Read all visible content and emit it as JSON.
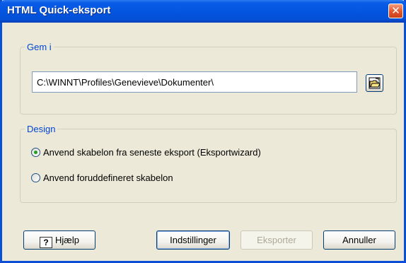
{
  "window": {
    "title": "HTML Quick-eksport",
    "close_symbol": "✕"
  },
  "save_group": {
    "legend": "Gem i",
    "path_value": "C:\\WINNT\\Profiles\\Genevieve\\Dokumenter\\"
  },
  "design_group": {
    "legend": "Design",
    "options": [
      {
        "label": "Anvend skabelon fra seneste eksport (Eksportwizard)",
        "checked": true
      },
      {
        "label": "Anvend foruddefineret skabelon",
        "checked": false
      }
    ]
  },
  "buttons": {
    "help": "Hjælp",
    "help_glyph": "?",
    "settings": "Indstillinger",
    "export": "Eksporter",
    "cancel": "Annuller"
  },
  "colors": {
    "title_bar": "#0455e0",
    "group_legend": "#0046d5",
    "dialog_bg": "#ece9d8"
  }
}
